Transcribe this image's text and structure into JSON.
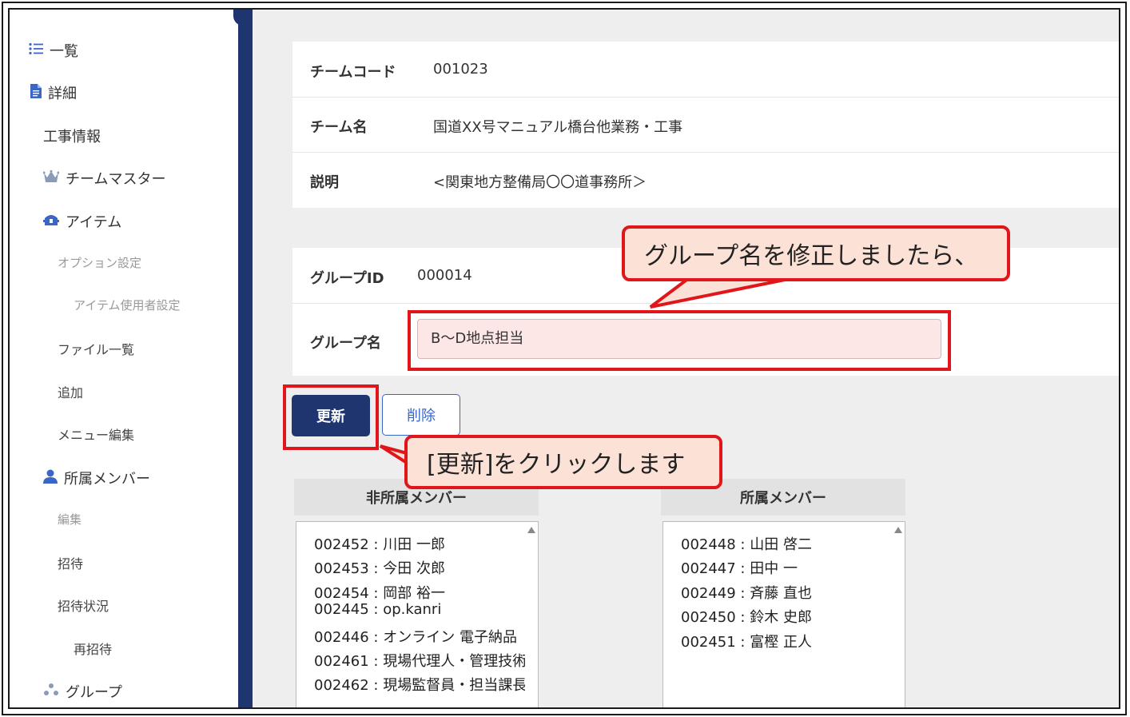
{
  "sidebar": {
    "items": [
      {
        "label": "一覧",
        "icon": "list-icon"
      },
      {
        "label": "詳細",
        "icon": "document-icon"
      },
      {
        "label": "工事情報"
      },
      {
        "label": "チームマスター",
        "icon": "crown-icon"
      },
      {
        "label": "アイテム",
        "icon": "toolbox-icon"
      },
      {
        "label": "オプション設定"
      },
      {
        "label": "アイテム使用者設定"
      },
      {
        "label": "ファイル一覧"
      },
      {
        "label": "追加"
      },
      {
        "label": "メニュー編集"
      },
      {
        "label": "所属メンバー",
        "icon": "user-icon"
      },
      {
        "label": "編集"
      },
      {
        "label": "招待"
      },
      {
        "label": "招待状況"
      },
      {
        "label": "再招待"
      },
      {
        "label": "グループ",
        "icon": "group-icon"
      }
    ]
  },
  "team": {
    "code_label": "チームコード",
    "code_value": "001023",
    "name_label": "チーム名",
    "name_value": "国道XX号マニュアル橋台他業務・工事",
    "desc_label": "説明",
    "desc_value": "<関東地方整備局〇〇道事務所＞"
  },
  "group": {
    "id_label": "グループID",
    "id_value": "000014",
    "name_label": "グループ名",
    "name_value": "B～D地点担当"
  },
  "buttons": {
    "update": "更新",
    "delete": "削除"
  },
  "non_members": {
    "header": "非所属メンバー",
    "items": [
      "002452 : 川田 一郎",
      "002453 : 今田 次郎",
      "002454 : 岡部 裕一",
      "002445 : op.kanri",
      "002446 : オンライン 電子納品",
      "002461 : 現場代理人・管理技術",
      "002462 : 現場監督員・担当課長"
    ]
  },
  "members": {
    "header": "所属メンバー",
    "items": [
      "002448 : 山田 啓二",
      "002447 : 田中 一",
      "002449 : 斉藤 直也",
      "002450 : 鈴木 史郎",
      "002451 : 富樫 正人"
    ]
  },
  "annotations": {
    "callout1": "グループ名を修正しましたら、",
    "callout2": "[更新]をクリックします"
  },
  "colors": {
    "accent": "#1f3570",
    "highlight": "#e0161b",
    "callout_bg": "#fbe1d6",
    "link": "#3a66c8"
  }
}
